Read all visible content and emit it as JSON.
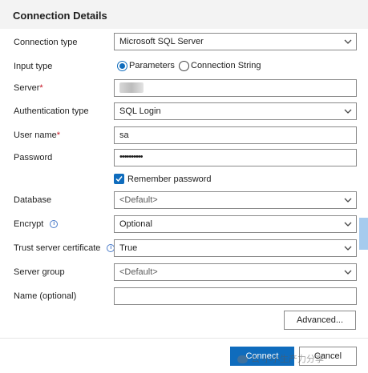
{
  "dialog": {
    "title": "Connection Details"
  },
  "fields": {
    "connection_type": {
      "label": "Connection type",
      "value": "Microsoft SQL Server"
    },
    "input_type": {
      "label": "Input type",
      "options": [
        "Parameters",
        "Connection String"
      ],
      "selected": "Parameters"
    },
    "server": {
      "label": "Server",
      "required_mark": "*",
      "value": ""
    },
    "authentication_type": {
      "label": "Authentication type",
      "value": "SQL Login"
    },
    "user_name": {
      "label": "User name",
      "required_mark": "*",
      "value": "sa"
    },
    "password": {
      "label": "Password",
      "value": "••••••••••"
    },
    "remember_password": {
      "label": "Remember password",
      "checked": true
    },
    "database": {
      "label": "Database",
      "value": "<Default>"
    },
    "encrypt": {
      "label": "Encrypt",
      "info_icon": "i",
      "value": "Optional"
    },
    "trust_server_certificate": {
      "label": "Trust server certificate",
      "info_icon": "i",
      "value": "True"
    },
    "server_group": {
      "label": "Server group",
      "value": "<Default>"
    },
    "name_optional": {
      "label": "Name (optional)",
      "value": ""
    }
  },
  "buttons": {
    "advanced": "Advanced...",
    "connect": "Connect",
    "cancel": "Cancel"
  },
  "watermark": {
    "text": "公 小小生产力分享"
  },
  "colors": {
    "accent": "#0f6cbd",
    "required": "#c50f1f",
    "header_bg": "#f3f3f3"
  }
}
